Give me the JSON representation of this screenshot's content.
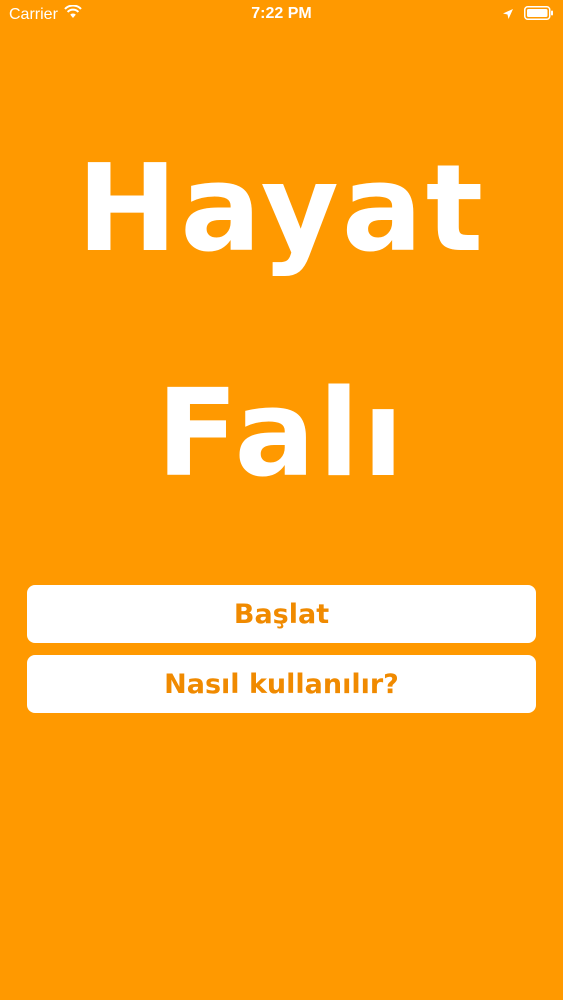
{
  "status_bar": {
    "carrier": "Carrier",
    "time": "7:22 PM",
    "icons": [
      "wifi-icon",
      "location-icon",
      "battery-icon"
    ]
  },
  "title": {
    "line1": "Hayat",
    "line2": "Falı"
  },
  "buttons": {
    "start_label": "Başlat",
    "help_label": "Nasıl kullanılır?"
  },
  "colors": {
    "background": "#FF9900",
    "button_bg": "#FFFFFF",
    "button_text": "#F08A00",
    "title_text": "#FFFFFF"
  }
}
